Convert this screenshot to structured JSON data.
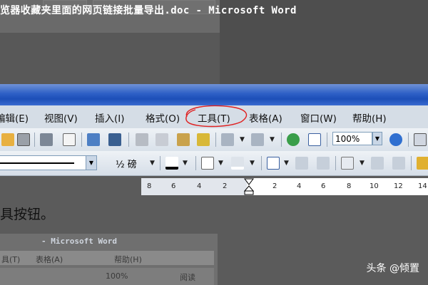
{
  "window": {
    "title": "览器收藏夹里面的网页链接批量导出.doc - Microsoft Word"
  },
  "menu": {
    "items": [
      {
        "label": "编辑(E)"
      },
      {
        "label": "视图(V)"
      },
      {
        "label": "插入(I)"
      },
      {
        "label": "格式(O)"
      },
      {
        "label": "工具(T)"
      },
      {
        "label": "表格(A)"
      },
      {
        "label": "窗口(W)"
      },
      {
        "label": "帮助(H)"
      }
    ],
    "highlighted": "工具(T)",
    "highlight_color": "#e02020"
  },
  "toolbar": {
    "zoom": "100%",
    "line_weight": "½ 磅"
  },
  "ruler": {
    "ticks": [
      "8",
      "6",
      "4",
      "2",
      "2",
      "4",
      "6",
      "8",
      "10",
      "12",
      "14"
    ]
  },
  "article": {
    "caption": "具按钮。"
  },
  "thumbnail": {
    "title": "- Microsoft Word",
    "menu": [
      "具(T)",
      "表格(A)",
      "帮助(H)"
    ],
    "zoom": "100%",
    "reading": "阅读"
  },
  "watermark": "头条 @倾置",
  "colors": {
    "title_bar": "#2d5fc6",
    "menu_bar": "#d5dde6",
    "toolbar": "#e4eaf0"
  }
}
